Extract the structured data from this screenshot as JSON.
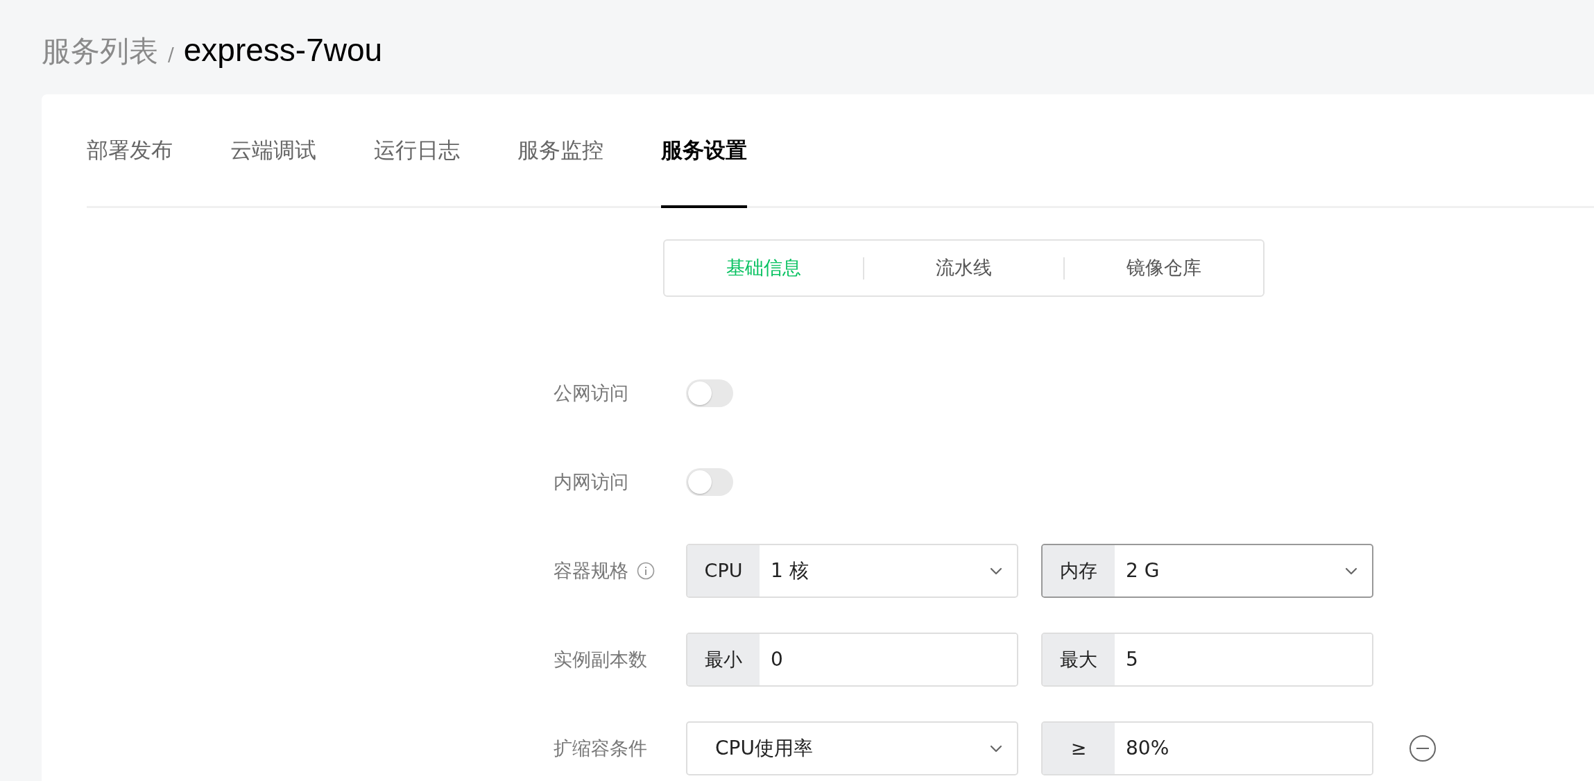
{
  "breadcrumb": {
    "parent": "服务列表",
    "separator": "/",
    "current": "express-7wou"
  },
  "tabs": [
    {
      "label": "部署发布",
      "selected": false
    },
    {
      "label": "云端调试",
      "selected": false
    },
    {
      "label": "运行日志",
      "selected": false
    },
    {
      "label": "服务监控",
      "selected": false
    },
    {
      "label": "服务设置",
      "selected": true
    }
  ],
  "subtabs": [
    {
      "label": "基础信息",
      "selected": true
    },
    {
      "label": "流水线",
      "selected": false
    },
    {
      "label": "镜像仓库",
      "selected": false
    }
  ],
  "form": [
    {
      "kind": "toggle",
      "label": "公网访问",
      "on": false
    },
    {
      "kind": "toggle",
      "label": "内网访问",
      "on": false
    },
    {
      "kind": "pair",
      "label": "容器规格",
      "info": true,
      "fields": [
        {
          "kind": "select",
          "addon": "CPU",
          "value": "1 核",
          "focused": false
        },
        {
          "kind": "select",
          "addon": "内存",
          "value": "2 G",
          "focused": true
        }
      ]
    },
    {
      "kind": "pair",
      "label": "实例副本数",
      "fields": [
        {
          "kind": "input",
          "addon": "最小",
          "value": "0",
          "focused": false
        },
        {
          "kind": "input",
          "addon": "最大",
          "value": "5",
          "focused": false
        }
      ]
    },
    {
      "kind": "pair",
      "label": "扩缩容条件",
      "removable": true,
      "fields": [
        {
          "kind": "select",
          "value": "CPU使用率",
          "focused": false
        },
        {
          "kind": "input",
          "addon": "≥",
          "value": "80%",
          "focused": false
        }
      ]
    }
  ]
}
